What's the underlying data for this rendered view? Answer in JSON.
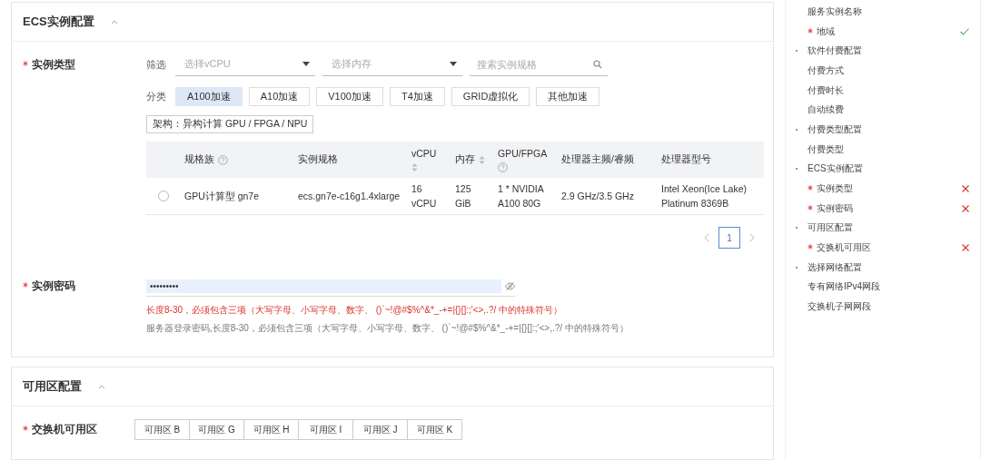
{
  "ecs_section": {
    "title": "ECS实例配置",
    "expanded": true,
    "instance_type": {
      "label": "实例类型",
      "required": true,
      "filter_label": "筛选",
      "vcpu_select": {
        "placeholder": "选择vCPU"
      },
      "memory_select": {
        "placeholder": "选择内存"
      },
      "search": {
        "placeholder": "搜索实例规格"
      },
      "category_label": "分类",
      "categories": [
        {
          "label": "A100加速",
          "selected": true
        },
        {
          "label": "A10加速",
          "selected": false
        },
        {
          "label": "V100加速",
          "selected": false
        },
        {
          "label": "T4加速",
          "selected": false
        },
        {
          "label": "GRID虚拟化",
          "selected": false
        },
        {
          "label": "其他加速",
          "selected": false
        }
      ],
      "arch_tag": "架构：异构计算 GPU / FPGA / NPU",
      "table": {
        "columns": [
          {
            "label": "规格族",
            "help": true,
            "sortable": false
          },
          {
            "label": "实例规格",
            "help": false,
            "sortable": false
          },
          {
            "label": "vCPU",
            "help": false,
            "sortable": true
          },
          {
            "label": "内存",
            "help": false,
            "sortable": true
          },
          {
            "label": "GPU/FPGA",
            "help": true,
            "sortable": false
          },
          {
            "label": "处理器主频/睿频",
            "help": false,
            "sortable": false
          },
          {
            "label": "处理器型号",
            "help": false,
            "sortable": false
          }
        ],
        "rows": [
          {
            "selected": false,
            "cells": [
              "GPU计算型 gn7e",
              "ecs.gn7e-c16g1.4xlarge",
              "16 vCPU",
              "125 GiB",
              "1 * NVIDIA A100 80G",
              "2.9 GHz/3.5 GHz",
              "Intel Xeon(Ice Lake) Platinum 8369B"
            ]
          }
        ]
      },
      "pagination": {
        "current": "1"
      }
    },
    "password": {
      "label": "实例密码",
      "required": true,
      "value": "•••••••••",
      "error": "长度8-30，必须包含三项（大写字母、小写字母、数字、 ()`~!@#$%^&*_-+=|{}[]:;'<>,.?/ 中的特殊符号）",
      "hint": "服务器登录密码,长度8-30，必须包含三项（大写字母、小写字母、数字、 ()`~!@#$%^&*_-+=|{}[]:;'<>,.?/ 中的特殊符号）"
    }
  },
  "zone_section": {
    "title": "可用区配置",
    "expanded": true,
    "switch_zone": {
      "label": "交换机可用区",
      "required": true,
      "options": [
        {
          "label": "可用区 B",
          "selected": false
        },
        {
          "label": "可用区 G",
          "selected": false
        },
        {
          "label": "可用区 H",
          "selected": false
        },
        {
          "label": "可用区 I",
          "selected": false
        },
        {
          "label": "可用区 J",
          "selected": false
        },
        {
          "label": "可用区 K",
          "selected": false
        }
      ]
    }
  },
  "nav": {
    "items": [
      {
        "label": "服务实例名称",
        "kind": "item",
        "required": false,
        "valid": false,
        "error": false
      },
      {
        "label": "地域",
        "kind": "item",
        "required": true,
        "valid": true,
        "error": false
      },
      {
        "label": "软件付费配置",
        "kind": "group",
        "required": false,
        "valid": false,
        "error": false
      },
      {
        "label": "付费方式",
        "kind": "item",
        "required": false,
        "valid": false,
        "error": false
      },
      {
        "label": "付费时长",
        "kind": "item",
        "required": false,
        "valid": false,
        "error": false
      },
      {
        "label": "自动续费",
        "kind": "item",
        "required": false,
        "valid": false,
        "error": false
      },
      {
        "label": "付费类型配置",
        "kind": "group",
        "required": false,
        "valid": false,
        "error": false
      },
      {
        "label": "付费类型",
        "kind": "item",
        "required": false,
        "valid": false,
        "error": false
      },
      {
        "label": "ECS实例配置",
        "kind": "group",
        "required": false,
        "valid": false,
        "error": false
      },
      {
        "label": "实例类型",
        "kind": "item",
        "required": true,
        "valid": false,
        "error": true
      },
      {
        "label": "实例密码",
        "kind": "item",
        "required": true,
        "valid": false,
        "error": true
      },
      {
        "label": "可用区配置",
        "kind": "group",
        "required": false,
        "valid": false,
        "error": false
      },
      {
        "label": "交换机可用区",
        "kind": "item",
        "required": true,
        "valid": false,
        "error": true
      },
      {
        "label": "选择网络配置",
        "kind": "group",
        "required": false,
        "valid": false,
        "error": false
      },
      {
        "label": "专有网络IPv4网段",
        "kind": "item",
        "required": false,
        "valid": false,
        "error": false
      },
      {
        "label": "交换机子网网段",
        "kind": "item",
        "required": false,
        "valid": false,
        "error": false
      }
    ]
  }
}
